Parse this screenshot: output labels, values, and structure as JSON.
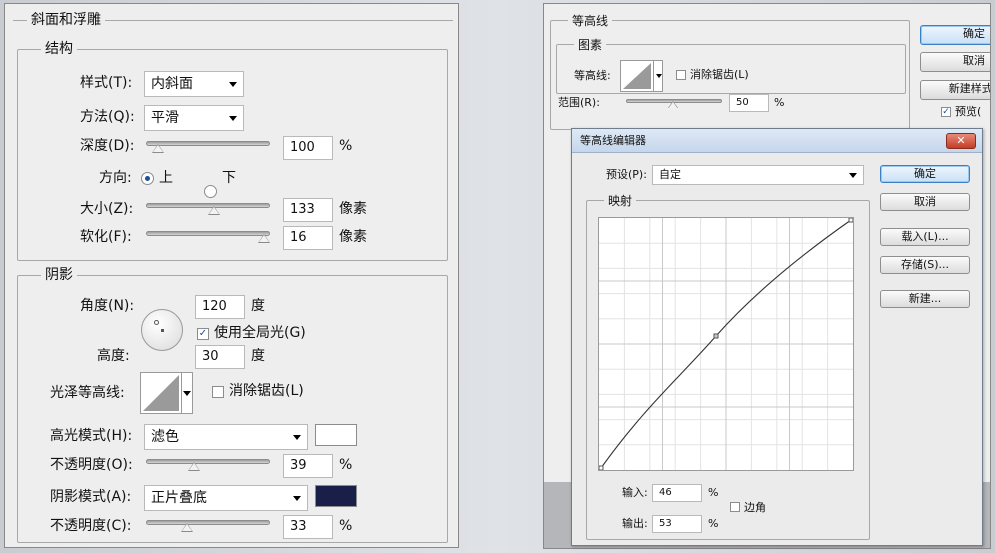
{
  "left": {
    "title": "斜面和浮雕",
    "structure": {
      "title": "结构",
      "style_label": "样式(T):",
      "style_value": "内斜面",
      "method_label": "方法(Q):",
      "method_value": "平滑",
      "depth_label": "深度(D):",
      "depth_value": "100",
      "depth_unit": "%",
      "direction_label": "方向:",
      "direction_up": "上",
      "direction_down": "下",
      "size_label": "大小(Z):",
      "size_value": "133",
      "size_unit": "像素",
      "soften_label": "软化(F):",
      "soften_value": "16",
      "soften_unit": "像素"
    },
    "shading": {
      "title": "阴影",
      "angle_label": "角度(N):",
      "angle_value": "120",
      "angle_unit": "度",
      "global_light_label": "使用全局光(G)",
      "altitude_label": "高度:",
      "altitude_value": "30",
      "altitude_unit": "度",
      "gloss_label": "光泽等高线:",
      "antialias_label": "消除锯齿(L)",
      "highlight_mode_label": "高光模式(H):",
      "highlight_mode_value": "滤色",
      "highlight_color": "#ffffff",
      "highlight_opacity_label": "不透明度(O):",
      "highlight_opacity_value": "39",
      "shadow_mode_label": "阴影模式(A):",
      "shadow_mode_value": "正片叠底",
      "shadow_color": "#1a1f4a",
      "shadow_opacity_label": "不透明度(C):",
      "shadow_opacity_value": "33",
      "percent": "%"
    }
  },
  "right": {
    "contour_title": "等高线",
    "elements_title": "图素",
    "contour_label": "等高线:",
    "antialias_label": "消除锯齿(L)",
    "range_label": "范围(R):",
    "range_value": "50",
    "percent": "%",
    "buttons": [
      "确定",
      "取消",
      "新建样式(",
      "预览("
    ]
  },
  "editor": {
    "title": "等高线编辑器",
    "preset_label": "预设(P):",
    "preset_value": "自定",
    "mapping_title": "映射",
    "input_label": "输入:",
    "input_value": "46",
    "output_label": "输出:",
    "output_value": "53",
    "percent": "%",
    "corner_label": "边角",
    "buttons": [
      "确定",
      "取消",
      "载入(L)...",
      "存储(S)...",
      "新建..."
    ],
    "close_glyph": "✕"
  }
}
